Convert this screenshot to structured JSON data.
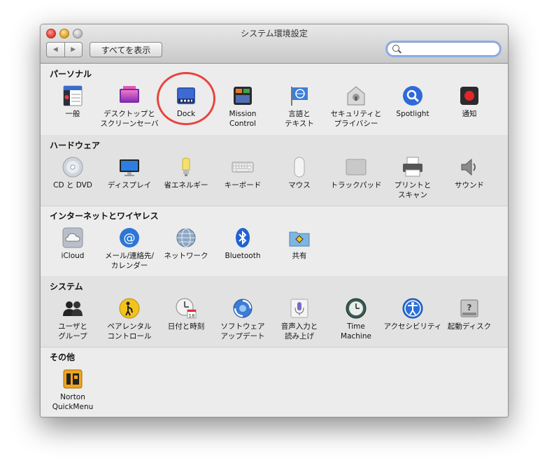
{
  "window": {
    "title": "システム環境設定",
    "nav_back": "◀",
    "nav_forward": "▶",
    "show_all": "すべてを表示",
    "search_value": ""
  },
  "sections": [
    {
      "title": "パーソナル",
      "items": [
        {
          "label": "一般",
          "icon": "general-icon"
        },
        {
          "label": "デスクトップと\nスクリーンセーバ",
          "icon": "desktop-icon"
        },
        {
          "label": "Dock",
          "icon": "dock-icon"
        },
        {
          "label": "Mission\nControl",
          "icon": "mission-control-icon"
        },
        {
          "label": "言語と\nテキスト",
          "icon": "language-icon"
        },
        {
          "label": "セキュリティと\nプライバシー",
          "icon": "security-icon"
        },
        {
          "label": "Spotlight",
          "icon": "spotlight-icon"
        },
        {
          "label": "通知",
          "icon": "notifications-icon"
        }
      ]
    },
    {
      "title": "ハードウェア",
      "items": [
        {
          "label": "CD と DVD",
          "icon": "cd-dvd-icon"
        },
        {
          "label": "ディスプレイ",
          "icon": "display-icon"
        },
        {
          "label": "省エネルギー",
          "icon": "energy-icon"
        },
        {
          "label": "キーボード",
          "icon": "keyboard-icon"
        },
        {
          "label": "マウス",
          "icon": "mouse-icon"
        },
        {
          "label": "トラックパッド",
          "icon": "trackpad-icon"
        },
        {
          "label": "プリントと\nスキャン",
          "icon": "printer-icon"
        },
        {
          "label": "サウンド",
          "icon": "sound-icon"
        }
      ]
    },
    {
      "title": "インターネットとワイヤレス",
      "items": [
        {
          "label": "iCloud",
          "icon": "icloud-icon"
        },
        {
          "label": "メール/連絡先/\nカレンダー",
          "icon": "mail-icon"
        },
        {
          "label": "ネットワーク",
          "icon": "network-icon"
        },
        {
          "label": "Bluetooth",
          "icon": "bluetooth-icon"
        },
        {
          "label": "共有",
          "icon": "sharing-icon"
        }
      ]
    },
    {
      "title": "システム",
      "items": [
        {
          "label": "ユーザと\nグループ",
          "icon": "users-icon"
        },
        {
          "label": "ペアレンタル\nコントロール",
          "icon": "parental-icon"
        },
        {
          "label": "日付と時刻",
          "icon": "date-time-icon"
        },
        {
          "label": "ソフトウェア\nアップデート",
          "icon": "software-update-icon"
        },
        {
          "label": "音声入力と\n読み上げ",
          "icon": "dictation-icon"
        },
        {
          "label": "Time\nMachine",
          "icon": "time-machine-icon"
        },
        {
          "label": "アクセシビリティ",
          "icon": "accessibility-icon"
        },
        {
          "label": "起動ディスク",
          "icon": "startup-disk-icon"
        }
      ]
    },
    {
      "title": "その他",
      "items": [
        {
          "label": "Norton QuickMenu",
          "icon": "norton-icon"
        }
      ]
    }
  ],
  "calendar_day": "18"
}
